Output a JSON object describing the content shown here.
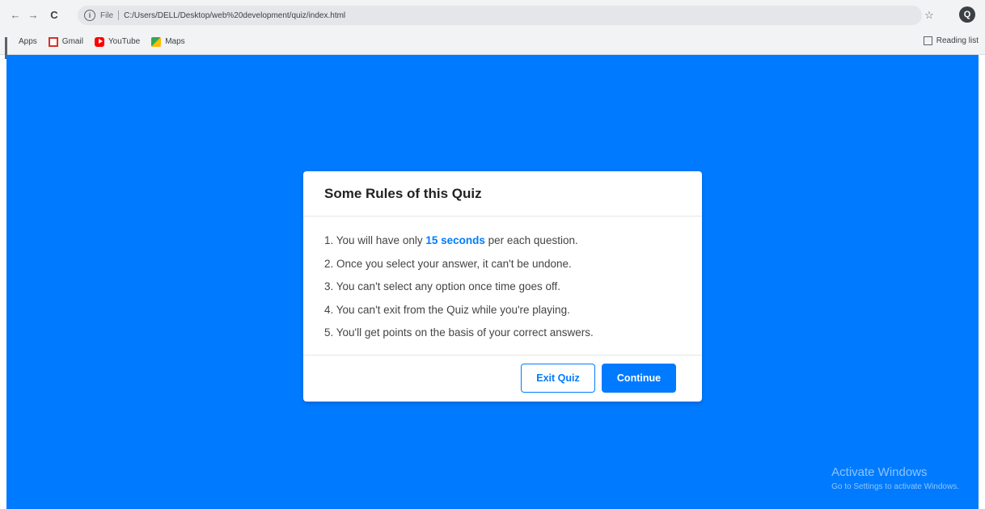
{
  "browser": {
    "back_icon": "←",
    "forward_icon": "→",
    "reload_icon": "C",
    "file_label": "File",
    "url": "C:/Users/DELL/Desktop/web%20development/quiz/index.html",
    "star_icon": "☆",
    "profile_initial": "Q",
    "bookmarks": [
      {
        "label": "Apps",
        "icon": "apps-grid"
      },
      {
        "label": "Gmail",
        "icon": "gmail"
      },
      {
        "label": "YouTube",
        "icon": "youtube"
      },
      {
        "label": "Maps",
        "icon": "maps"
      }
    ],
    "reading_list_label": "Reading list"
  },
  "page": {
    "background": "#007bff"
  },
  "info_box": {
    "title": "Some Rules of this Quiz",
    "rules": [
      {
        "prefix": "1. You will have only ",
        "highlight": "15 seconds",
        "suffix": " per each question."
      },
      {
        "text": "2. Once you select your answer, it can't be undone."
      },
      {
        "text": "3. You can't select any option once time goes off."
      },
      {
        "text": "4. You can't exit from the Quiz while you're playing."
      },
      {
        "text": "5. You'll get points on the basis of your correct answers."
      }
    ],
    "exit_button": "Exit Quiz",
    "continue_button": "Continue"
  },
  "watermark": {
    "line1": "Activate Windows",
    "line2": "Go to Settings to activate Windows."
  }
}
